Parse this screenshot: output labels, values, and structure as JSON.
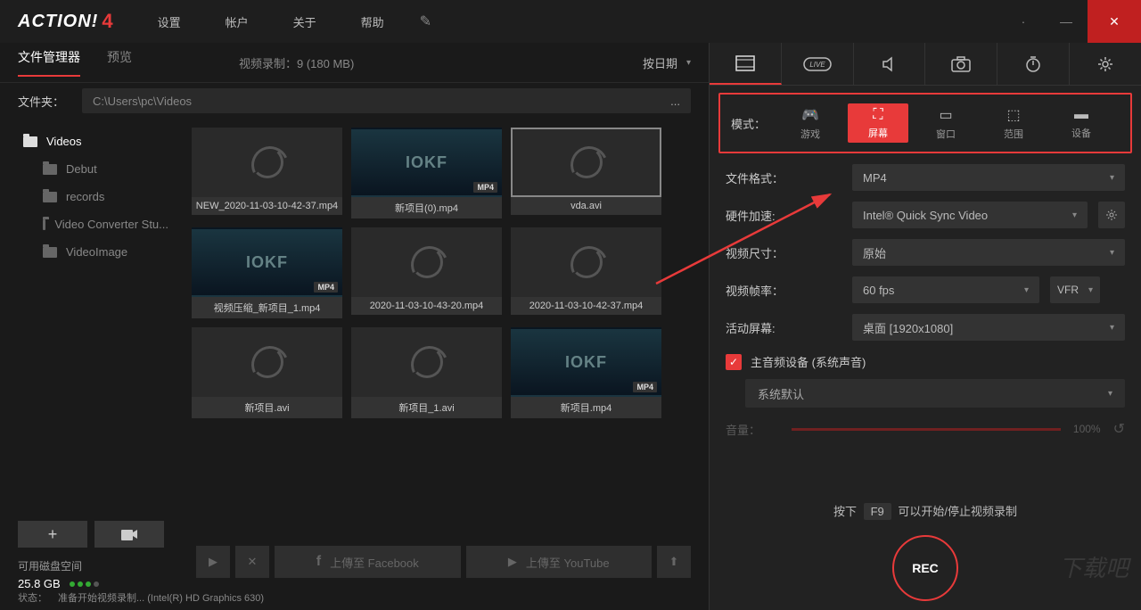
{
  "logo": {
    "text": "ACTION!",
    "version": "4"
  },
  "topMenu": {
    "settings": "设置",
    "account": "帐户",
    "about": "关于",
    "help": "帮助"
  },
  "leftHeader": {
    "tabFiles": "文件管理器",
    "tabPreview": "预览",
    "recInfo": "视频录制：9 (180 MB)",
    "sortLabel": "按日期"
  },
  "folderRow": {
    "label": "文件夹：",
    "path": "C:\\Users\\pc\\Videos"
  },
  "tree": {
    "root": "Videos",
    "items": [
      "Debut",
      "records",
      "Video Converter Stu...",
      "VideoImage"
    ]
  },
  "thumbs": [
    {
      "name": "NEW_2020-11-03-10-42-37.mp4",
      "type": "spinner",
      "badge": ""
    },
    {
      "name": "新项目(0).mp4",
      "type": "joker",
      "badge": "MP4"
    },
    {
      "name": "vda.avi",
      "type": "spinner",
      "selected": true,
      "badge": ""
    },
    {
      "name": "视频压缩_新项目_1.mp4",
      "type": "joker",
      "badge": "MP4"
    },
    {
      "name": "2020-11-03-10-43-20.mp4",
      "type": "spinner",
      "badge": ""
    },
    {
      "name": "2020-11-03-10-42-37.mp4",
      "type": "spinner",
      "badge": ""
    },
    {
      "name": "新项目.avi",
      "type": "spinner",
      "badge": ""
    },
    {
      "name": "新项目_1.avi",
      "type": "spinner",
      "badge": ""
    },
    {
      "name": "新项目.mp4",
      "type": "joker",
      "badge": "MP4"
    }
  ],
  "disk": {
    "label": "可用磁盘空间",
    "value": "25.8 GB"
  },
  "actions": {
    "play": "▶",
    "del": "✕",
    "fb": "上傳至 Facebook",
    "yt": "上傳至 YouTube",
    "up": "⬆"
  },
  "status": {
    "label": "状态：",
    "text": "准备开始视频录制...  (Intel(R) HD Graphics 630)"
  },
  "modeSection": {
    "label": "模式：",
    "game": "游戏",
    "screen": "屏幕",
    "window": "窗口",
    "region": "范围",
    "device": "设备"
  },
  "settings": {
    "formatLabel": "文件格式：",
    "formatVal": "MP4",
    "hwLabel": "硬件加速:",
    "hwVal": "Intel® Quick Sync Video",
    "sizeLabel": "视频尺寸：",
    "sizeVal": "原始",
    "fpsLabel": "视频帧率：",
    "fpsVal": "60 fps",
    "vfr": "VFR",
    "activeLabel": "活动屏幕:",
    "activeVal": "桌面 [1920x1080]",
    "audioChk": "主音频设备 (系统声音)",
    "audioDev": "系统默认",
    "volLabel": "音量：",
    "volVal": "100%"
  },
  "rec": {
    "hint1": "按下",
    "key": "F9",
    "hint2": "可以开始/停止视频录制",
    "btn": "REC"
  },
  "watermark": "下载吧"
}
